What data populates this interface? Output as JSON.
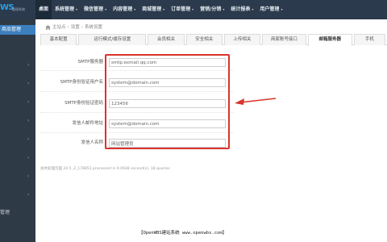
{
  "header": {
    "logo_text": "WS",
    "logo_sub": "管理系统",
    "nav": [
      {
        "label": "桌面"
      },
      {
        "label": "系统管理"
      },
      {
        "label": "微信管理"
      },
      {
        "label": "内容管理"
      },
      {
        "label": "商城管理"
      },
      {
        "label": "订单管理"
      },
      {
        "label": "营销/分销"
      },
      {
        "label": "统计报表"
      },
      {
        "label": "用户管理"
      }
    ],
    "dropdown_glyph": "▾"
  },
  "sidebar": {
    "active_item": "商品管理",
    "arrow_glyph": "›",
    "bottom_item": "管理"
  },
  "breadcrumb": {
    "items": [
      "主站点",
      "设置",
      "系统设置"
    ],
    "separator": "›"
  },
  "tabs": [
    {
      "label": "基本配置"
    },
    {
      "label": "运行模式/缓存设置"
    },
    {
      "label": "会员相关"
    },
    {
      "label": "安全相关"
    },
    {
      "label": "上传相关"
    },
    {
      "label": "商家账号接口"
    },
    {
      "label": "邮箱服务器"
    },
    {
      "label": "手机"
    }
  ],
  "form": {
    "smtp_server": {
      "label": "SMTP服务器",
      "value": "smtp.exmail.qq.com"
    },
    "smtp_user": {
      "label": "SMTP身份验证用户名",
      "value": "system@domain.com"
    },
    "smtp_password": {
      "label": "SMTP身份验证密码",
      "value": "123456"
    },
    "sender_email": {
      "label": "发信人邮件地址",
      "value": "system@domain.com"
    },
    "sender_name": {
      "label": "发信人名称",
      "value": "网站管理员"
    }
  },
  "footer_note": "总共处理页面 24.5 ,2_178851 processed in 0.0938 second(s), 18 queries",
  "watermark": "【OpenWBS建站系统 www.openwbs.com】",
  "colors": {
    "topbar": "#2b3a4c",
    "sidebar": "#2f3a47",
    "accent": "#3c7fbf",
    "highlight": "#d9342b"
  }
}
